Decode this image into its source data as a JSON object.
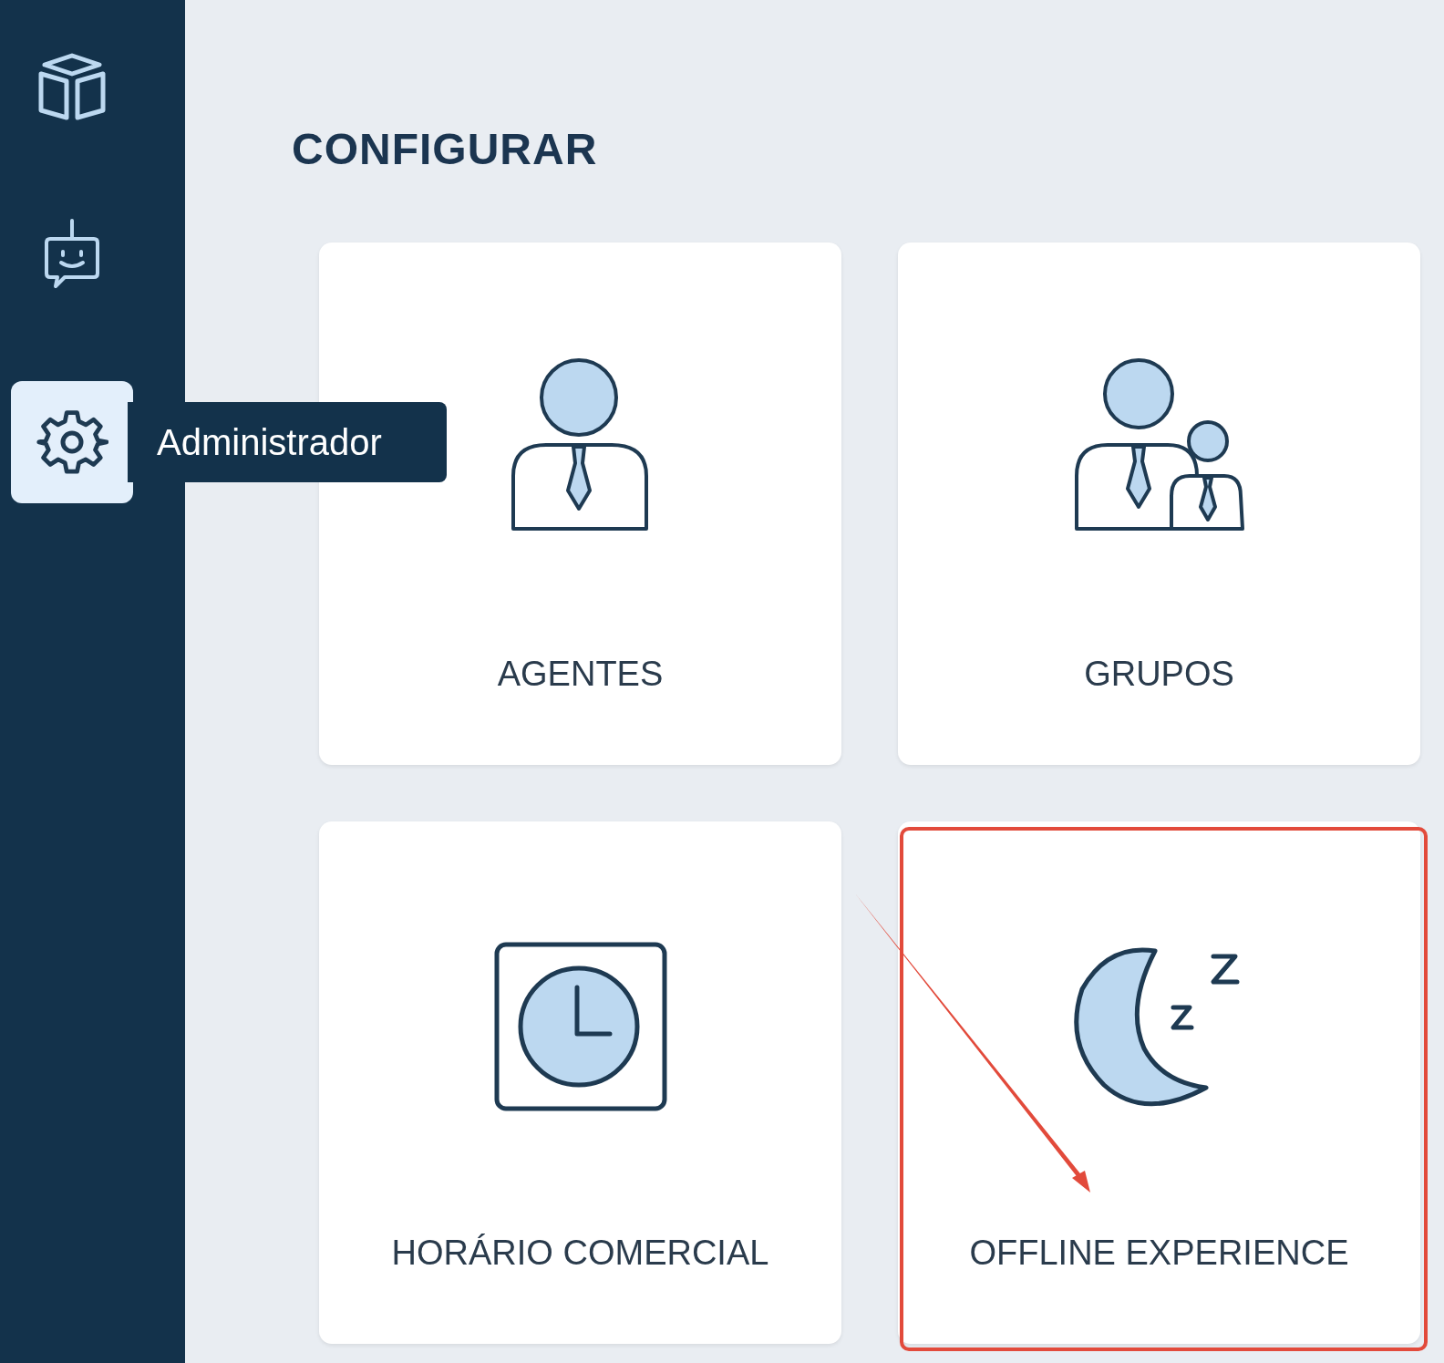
{
  "sidebar": {
    "items": [
      {
        "kind": "cube",
        "selected": false
      },
      {
        "kind": "bot",
        "selected": false
      },
      {
        "kind": "gear",
        "selected": true
      }
    ]
  },
  "tooltip": {
    "label": "Administrador"
  },
  "page": {
    "title": "CONFIGURAR"
  },
  "cards": [
    {
      "kind": "agent",
      "label": "AGENTES",
      "highlighted": false
    },
    {
      "kind": "group",
      "label": "GRUPOS",
      "highlighted": false
    },
    {
      "kind": "clock",
      "label": "HORÁRIO COMERCIAL",
      "highlighted": false
    },
    {
      "kind": "moon",
      "label": "OFFLINE EXPERIENCE",
      "highlighted": true
    }
  ]
}
